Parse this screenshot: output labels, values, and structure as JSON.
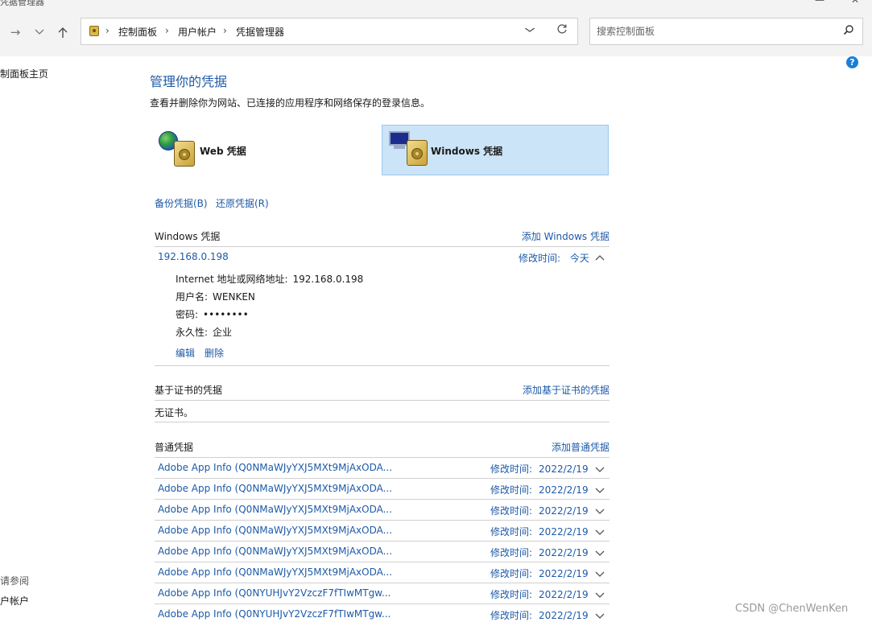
{
  "titlebar": {
    "title": "凭据管理器",
    "minimize": "—",
    "close": "✕"
  },
  "nav": {
    "breadcrumb": [
      "控制面板",
      "用户帐户",
      "凭据管理器"
    ],
    "search_placeholder": "搜索控制面板"
  },
  "left_nav": {
    "home": "控制面板主页",
    "see_also": "另请参阅",
    "user_accounts": "用户帐户"
  },
  "main": {
    "title": "管理你的凭据",
    "description": "查看并删除你为网站、已连接的应用程序和网络保存的登录信息。",
    "tiles": {
      "web": "Web 凭据",
      "windows": "Windows 凭据",
      "selected": "windows"
    },
    "backup": "备份凭据(B)",
    "restore": "还原凭据(R)"
  },
  "windows_section": {
    "title": "Windows 凭据",
    "add": "添加 Windows 凭据",
    "entry": {
      "name": "192.168.0.198",
      "modified_label": "修改时间:",
      "modified_value": "今天",
      "address_label": "Internet 地址或网络地址:",
      "address_value": "192.168.0.198",
      "user_label": "用户名:",
      "user_value": "WENKEN",
      "password_label": "密码:",
      "password_value": "••••••••",
      "persistence_label": "永久性:",
      "persistence_value": "企业",
      "edit": "编辑",
      "delete": "删除"
    }
  },
  "cert_section": {
    "title": "基于证书的凭据",
    "add": "添加基于证书的凭据",
    "empty": "无证书。"
  },
  "generic_section": {
    "title": "普通凭据",
    "add": "添加普通凭据",
    "modified_label": "修改时间:",
    "items": [
      {
        "name": "Adobe App Info (Q0NMaWJyYXJ5MXt9MjAxODA...",
        "date": "2022/2/19"
      },
      {
        "name": "Adobe App Info (Q0NMaWJyYXJ5MXt9MjAxODA...",
        "date": "2022/2/19"
      },
      {
        "name": "Adobe App Info (Q0NMaWJyYXJ5MXt9MjAxODA...",
        "date": "2022/2/19"
      },
      {
        "name": "Adobe App Info (Q0NMaWJyYXJ5MXt9MjAxODA...",
        "date": "2022/2/19"
      },
      {
        "name": "Adobe App Info (Q0NMaWJyYXJ5MXt9MjAxODA...",
        "date": "2022/2/19"
      },
      {
        "name": "Adobe App Info (Q0NMaWJyYXJ5MXt9MjAxODA...",
        "date": "2022/2/19"
      },
      {
        "name": "Adobe App Info (Q0NYUHJvY2VzczF7fTIwMTgw...",
        "date": "2022/2/19"
      },
      {
        "name": "Adobe App Info (Q0NYUHJvY2VzczF7fTIwMTgw...",
        "date": "2022/2/19"
      }
    ]
  },
  "watermark": "CSDN @ChenWenKen",
  "colors": {
    "link": "#1e5aa8",
    "selected_tile": "#cce4f7",
    "selected_border": "#99c9ef",
    "help": "#1a7fd4"
  },
  "icons": [
    "back-icon",
    "forward-icon",
    "recent-icon",
    "up-icon",
    "control-panel-icon",
    "chevron-down-icon",
    "refresh-icon",
    "search-icon",
    "help-icon",
    "globe-icon",
    "vault-icon",
    "monitor-icon",
    "chevron-up-icon"
  ]
}
